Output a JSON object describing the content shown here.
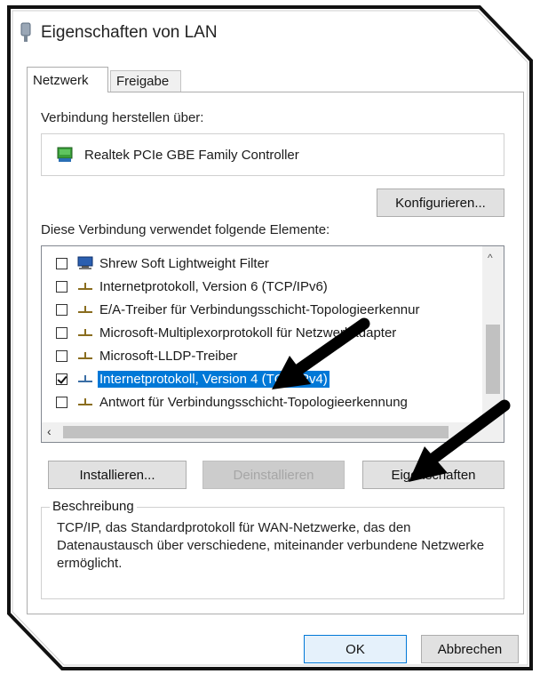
{
  "window": {
    "title": "Eigenschaften von LAN",
    "icon": "network-adapter-icon"
  },
  "tabs": [
    {
      "label": "Netzwerk",
      "active": true
    },
    {
      "label": "Freigabe",
      "active": false
    }
  ],
  "connection": {
    "label": "Verbindung herstellen über:",
    "adapter": "Realtek PCIe GBE Family Controller",
    "configure_button": "Konfigurieren..."
  },
  "elements": {
    "label": "Diese Verbindung verwendet folgende Elemente:",
    "items": [
      {
        "text": "Shrew Soft Lightweight Filter",
        "checked": false,
        "icon": "computer-icon",
        "selected": false
      },
      {
        "text": "Internetprotokoll, Version 6 (TCP/IPv6)",
        "checked": false,
        "icon": "protocol-icon",
        "selected": false
      },
      {
        "text": "E/A-Treiber für Verbindungsschicht-Topologieerkennur",
        "checked": false,
        "icon": "protocol-icon",
        "selected": false
      },
      {
        "text": "Microsoft-Multiplexorprotokoll für Netzwerkadapter",
        "checked": false,
        "icon": "protocol-icon",
        "selected": false
      },
      {
        "text": "Microsoft-LLDP-Treiber",
        "checked": false,
        "icon": "protocol-icon",
        "selected": false
      },
      {
        "text": "Internetprotokoll, Version 4 (TCP/IPv4)",
        "checked": true,
        "icon": "protocol-icon",
        "selected": true
      },
      {
        "text": "Antwort für Verbindungsschicht-Topologieerkennung",
        "checked": false,
        "icon": "protocol-icon",
        "selected": false
      }
    ]
  },
  "buttons": {
    "install": "Installieren...",
    "uninstall": "Deinstallieren",
    "properties": "Eigenschaften",
    "ok": "OK",
    "cancel": "Abbrechen"
  },
  "description": {
    "legend": "Beschreibung",
    "text": "TCP/IP, das Standardprotokoll für WAN-Netzwerke, das den Datenaustausch über verschiedene, miteinander verbundene Netzwerke ermöglicht."
  },
  "colors": {
    "selection": "#0078d7",
    "annotation_arrow": "#000000"
  }
}
